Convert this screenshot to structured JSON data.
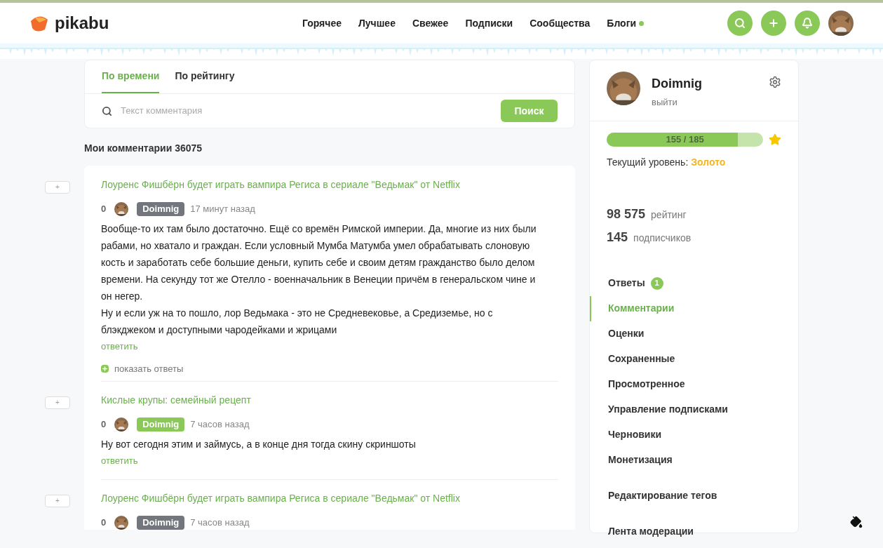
{
  "header": {
    "logo": "pikabu",
    "nav": [
      {
        "label": "Горячее",
        "dot": false
      },
      {
        "label": "Лучшее",
        "dot": false
      },
      {
        "label": "Свежее",
        "dot": false
      },
      {
        "label": "Подписки",
        "dot": false
      },
      {
        "label": "Сообщества",
        "dot": false
      },
      {
        "label": "Блоги",
        "dot": true
      }
    ],
    "actions": [
      {
        "kind": "search"
      },
      {
        "kind": "add"
      },
      {
        "kind": "bell"
      }
    ]
  },
  "tabs": [
    {
      "label": "По времени",
      "selected": true
    },
    {
      "label": "По рейтингу",
      "selected": false
    }
  ],
  "search": {
    "placeholder": "Текст комментария",
    "button": "Поиск"
  },
  "heading": "Мои комментарии 36075",
  "comments": [
    {
      "expand": "+",
      "title": "Лоуренс Фишбёрн будет играть вампира Региса в сериале \"Ведьмак\" от Netflix",
      "score": "0",
      "author": "Doimnig",
      "color": "#74767e",
      "time": "17 минут назад",
      "paragraphs": [
        "Вообще-то их там было достаточно. Ещё со времён Римской империи. Да, многие из них были рабами, но хватало и граждан. Если условный Мумба Матумба умел обрабатывать слоновую кость и заработать себе большие деньги, купить себе и своим детям гражданство было делом времени. На секунду тот же Отелло - военначальник в Венеции причём в генеральском чине и он негер.",
        "Ну и если уж на то пошло, лор Ведьмака - это не Средневековье, а Средиземье, но с блэкджеком и доступными чародейками и жрицами"
      ],
      "reply": "ответить",
      "show_replies": "показать ответы"
    },
    {
      "expand": "+",
      "title": "Кислые крупы: семейный рецепт",
      "score": "0",
      "author": "Doimnig",
      "color": "#8ac858",
      "time": "7 часов назад",
      "paragraphs": [
        "Ну вот сегодня этим и займусь, а в конце дня тогда скину скриншоты"
      ],
      "reply": "ответить"
    },
    {
      "expand": "+",
      "title": "Лоуренс Фишбёрн будет играть вампира Региса в сериале \"Ведьмак\" от Netflix",
      "score": "0",
      "author": "Doimnig",
      "color": "#74767e",
      "time": "7 часов назад"
    }
  ],
  "profile": {
    "name": "Doimnig",
    "logout": "выйти",
    "progress": {
      "level": 0.838,
      "reading": "155 / 185"
    },
    "level_label": "Текущий уровень:",
    "level_value": "Золото",
    "stats": [
      {
        "value": "98 575",
        "label": "рейтинг"
      },
      {
        "value": "145",
        "label": "подписчиков"
      }
    ],
    "menu": [
      {
        "label": "Ответы",
        "badge": "1",
        "selected": false
      },
      {
        "label": "Комментарии",
        "selected": true
      },
      {
        "label": "Оценки",
        "selected": false
      },
      {
        "label": "Сохраненные",
        "selected": false
      },
      {
        "label": "Просмотренное",
        "selected": false
      },
      {
        "label": "Управление подписками",
        "selected": false
      },
      {
        "label": "Черновики",
        "selected": false
      },
      {
        "label": "Монетизация",
        "selected": false
      },
      {
        "label": "Редактирование тегов",
        "selected": false,
        "gap": true
      },
      {
        "label": "Лента модерации",
        "selected": false,
        "gap": true
      }
    ]
  }
}
